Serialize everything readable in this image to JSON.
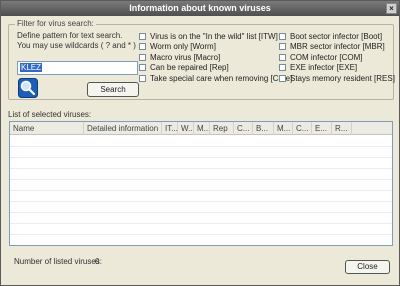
{
  "window": {
    "title": "Information about known viruses"
  },
  "filter": {
    "group_label": "Filter for virus search:",
    "hint": "Define pattern for text search. You may use wildcards ( ? and * )",
    "pattern_value": "KLEZ",
    "search_label": "Search"
  },
  "options_left": [
    {
      "label": "Virus is on the \"In the wild\" list [ITW]",
      "checked": false
    },
    {
      "label": "Worm only [Worm]",
      "checked": false
    },
    {
      "label": "Macro virus [Macro]",
      "checked": false
    },
    {
      "label": "Can be repaired [Rep]",
      "checked": false
    },
    {
      "label": "Take special care when removing [Care]",
      "checked": false
    }
  ],
  "options_right": [
    {
      "label": "Boot sector infector [Boot]",
      "checked": false
    },
    {
      "label": "MBR sector infector [MBR]",
      "checked": false
    },
    {
      "label": "COM infector [COM]",
      "checked": false
    },
    {
      "label": "EXE infector [EXE]",
      "checked": false
    },
    {
      "label": "Stays memory resident [RES]",
      "checked": false
    }
  ],
  "list": {
    "label": "List of selected viruses:",
    "columns": [
      "Name",
      "Detailed information",
      "IT...",
      "W...",
      "M...",
      "Rep",
      "C...",
      "B...",
      "M...",
      "C...",
      "E...",
      "R..."
    ],
    "rows": []
  },
  "status": {
    "label": "Number of listed viruses:",
    "count": "0"
  },
  "close_label": "Close"
}
